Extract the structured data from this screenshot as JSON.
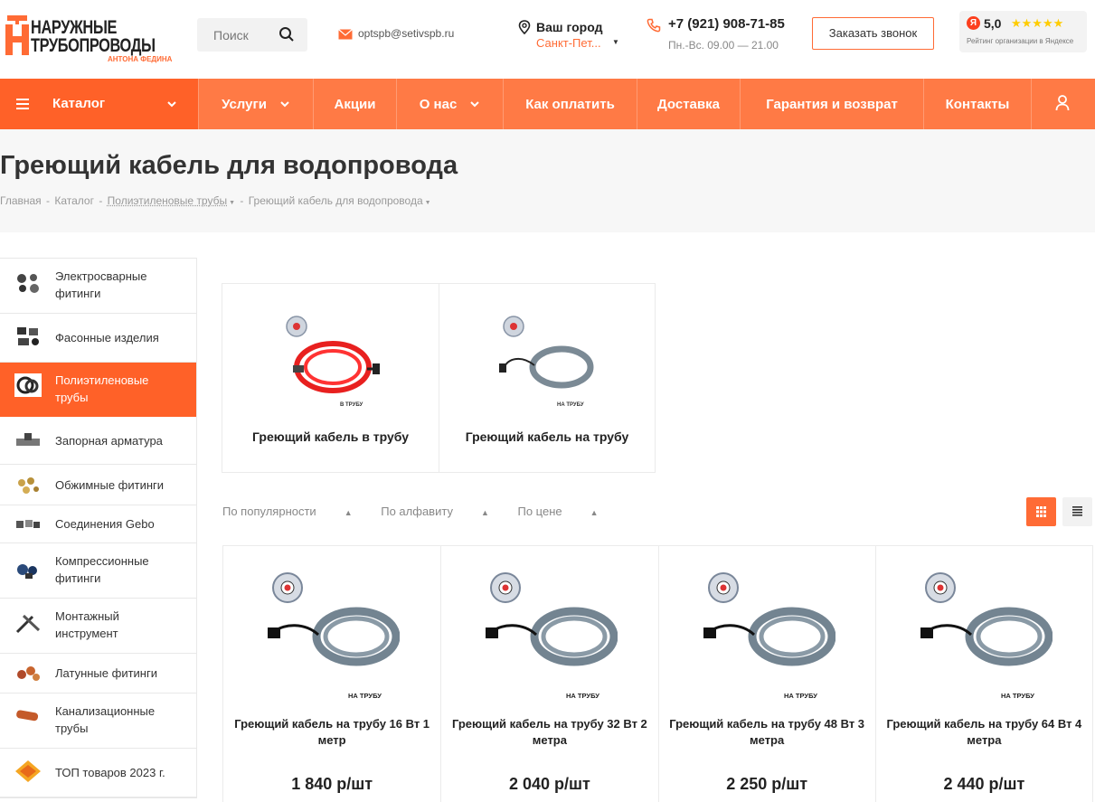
{
  "header": {
    "logo": {
      "line1": "НАРУЖНЫЕ",
      "line2": "ТРУБОПРОВОДЫ",
      "line3": "АНТОНА ФЕДИНА"
    },
    "search_placeholder": "Поиск",
    "email": "optspb@setivspb.ru",
    "city_label": "Ваш город",
    "city_value": "Санкт-Пет...",
    "phone": "+7 (921) 908-71-85",
    "hours": "Пн.-Вс.  09.00 — 21.00",
    "callback_label": "Заказать звонок",
    "yandex": {
      "badge": "Я",
      "rating": "5,0",
      "stars": "★★★★★",
      "caption": "Рейтинг организации в Яндексе"
    }
  },
  "nav": {
    "catalog": "Каталог",
    "items": [
      "Услуги",
      "Акции",
      "О нас",
      "Как оплатить",
      "Доставка",
      "Гарантия и возврат",
      "Контакты"
    ]
  },
  "page": {
    "title": "Греющий кабель для водопровода",
    "breadcrumbs": [
      "Главная",
      "Каталог",
      "Полиэтиленовые трубы",
      "Греющий кабель для водопровода"
    ]
  },
  "sidebar": {
    "items": [
      "Электросварные фитинги",
      "Фасонные изделия",
      "Полиэтиленовые трубы",
      "Запорная арматура",
      "Обжимные фитинги",
      "Соединения Gebo",
      "Компрессионные фитинги",
      "Монтажный инструмент",
      "Латунные фитинги",
      "Канализационные трубы",
      "ТОП товаров 2023 г."
    ],
    "active_index": 2
  },
  "subcategories": [
    {
      "name": "Греющий кабель в трубу",
      "img_caption": "В ТРУБУ"
    },
    {
      "name": "Греющий кабель на трубу",
      "img_caption": "НА ТРУБУ"
    }
  ],
  "sort": {
    "options": [
      "По популярности",
      "По алфавиту",
      "По цене"
    ]
  },
  "products": [
    {
      "name": "Греющий кабель на трубу 16 Вт 1 метр",
      "price": "1 840 р/шт",
      "img_caption": "НА ТРУБУ"
    },
    {
      "name": "Греющий кабель на трубу 32 Вт 2 метра",
      "price": "2 040 р/шт",
      "img_caption": "НА ТРУБУ"
    },
    {
      "name": "Греющий кабель на трубу 48 Вт 3 метра",
      "price": "2 250 р/шт",
      "img_caption": "НА ТРУБУ"
    },
    {
      "name": "Греющий кабель на трубу 64 Вт 4 метра",
      "price": "2 440 р/шт",
      "img_caption": "НА ТРУБУ"
    }
  ],
  "colors": {
    "accent": "#ff6b35",
    "nav": "#ff7a45",
    "catalog": "#ff6128"
  }
}
